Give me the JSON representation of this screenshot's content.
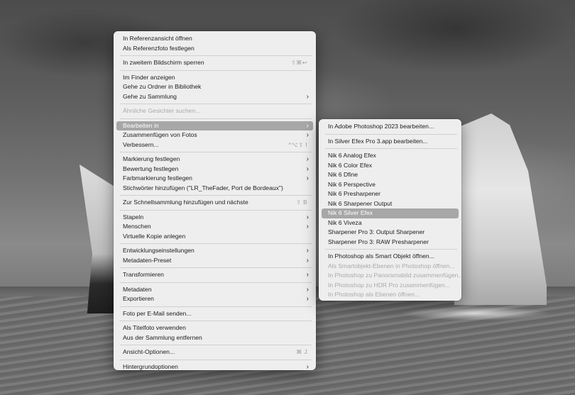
{
  "main_menu": [
    {
      "type": "item",
      "label": "In Referenzansicht öffnen"
    },
    {
      "type": "item",
      "label": "Als Referenzfoto festlegen"
    },
    {
      "type": "sep"
    },
    {
      "type": "item",
      "label": "In zweitem Bildschirm sperren",
      "shortcut": "⇧⌘↩"
    },
    {
      "type": "sep"
    },
    {
      "type": "item",
      "label": "Im Finder anzeigen"
    },
    {
      "type": "item",
      "label": "Gehe zu Ordner in Bibliothek"
    },
    {
      "type": "item",
      "label": "Gehe zu Sammlung",
      "submenu": true
    },
    {
      "type": "sep"
    },
    {
      "type": "item",
      "label": "Ähnliche Gesichter suchen...",
      "disabled": true
    },
    {
      "type": "sep"
    },
    {
      "type": "item",
      "label": "Bearbeiten in",
      "submenu": true,
      "highlight": true
    },
    {
      "type": "item",
      "label": "Zusammenfügen von Fotos",
      "submenu": true
    },
    {
      "type": "item",
      "label": "Verbessern...",
      "shortcut": "^⌥⇧ I"
    },
    {
      "type": "sep"
    },
    {
      "type": "item",
      "label": "Markierung festlegen",
      "submenu": true
    },
    {
      "type": "item",
      "label": "Bewertung festlegen",
      "submenu": true
    },
    {
      "type": "item",
      "label": "Farbmarkierung festlegen",
      "submenu": true
    },
    {
      "type": "item",
      "label": "Stichwörter hinzufügen (\"LR_TheFader, Port de Bordeaux\")"
    },
    {
      "type": "sep"
    },
    {
      "type": "item",
      "label": "Zur Schnellsammlung hinzufügen und nächste",
      "shortcut": "⇧ B"
    },
    {
      "type": "sep"
    },
    {
      "type": "item",
      "label": "Stapeln",
      "submenu": true
    },
    {
      "type": "item",
      "label": "Menschen",
      "submenu": true
    },
    {
      "type": "item",
      "label": "Virtuelle Kopie anlegen"
    },
    {
      "type": "sep"
    },
    {
      "type": "item",
      "label": "Entwicklungseinstellungen",
      "submenu": true
    },
    {
      "type": "item",
      "label": "Metadaten-Preset",
      "submenu": true
    },
    {
      "type": "sep"
    },
    {
      "type": "item",
      "label": "Transformieren",
      "submenu": true
    },
    {
      "type": "sep"
    },
    {
      "type": "item",
      "label": "Metadaten",
      "submenu": true
    },
    {
      "type": "item",
      "label": "Exportieren",
      "submenu": true
    },
    {
      "type": "sep"
    },
    {
      "type": "item",
      "label": "Foto per E-Mail senden..."
    },
    {
      "type": "sep"
    },
    {
      "type": "item",
      "label": "Als Titelfoto verwenden"
    },
    {
      "type": "item",
      "label": "Aus der Sammlung entfernen"
    },
    {
      "type": "sep"
    },
    {
      "type": "item",
      "label": "Ansicht-Optionen...",
      "shortcut": "⌘ J"
    },
    {
      "type": "sep"
    },
    {
      "type": "item",
      "label": "Hintergrundoptionen",
      "submenu": true
    }
  ],
  "sub_menu": [
    {
      "type": "item",
      "label": "In Adobe Photoshop 2023 bearbeiten..."
    },
    {
      "type": "sep"
    },
    {
      "type": "item",
      "label": "In Silver Efex Pro 3.app bearbeiten..."
    },
    {
      "type": "sep"
    },
    {
      "type": "item",
      "label": "Nik 6 Analog Efex"
    },
    {
      "type": "item",
      "label": "Nik 6 Color Efex"
    },
    {
      "type": "item",
      "label": "Nik 6 Dfine"
    },
    {
      "type": "item",
      "label": "Nik 6 Perspective"
    },
    {
      "type": "item",
      "label": "Nik 6 Presharpener"
    },
    {
      "type": "item",
      "label": "Nik 6 Sharpener Output"
    },
    {
      "type": "item",
      "label": "Nik 6 Silver Efex",
      "highlight": true
    },
    {
      "type": "item",
      "label": "Nik 6 Viveza"
    },
    {
      "type": "item",
      "label": "Sharpener Pro 3: Output Sharpener"
    },
    {
      "type": "item",
      "label": "Sharpener Pro 3: RAW Presharpener"
    },
    {
      "type": "sep"
    },
    {
      "type": "item",
      "label": "In Photoshop als Smart Objekt öffnen..."
    },
    {
      "type": "item",
      "label": "Als Smartobjekt-Ebenen in Photoshop öffnen...",
      "disabled": true
    },
    {
      "type": "item",
      "label": "In Photoshop zu Panoramabild zusammenfügen...",
      "disabled": true
    },
    {
      "type": "item",
      "label": "In Photoshop zu HDR Pro zusammenfügen...",
      "disabled": true
    },
    {
      "type": "item",
      "label": "In Photoshop als Ebenen öffnen...",
      "disabled": true
    }
  ],
  "icons": {
    "submenu_arrow": "›"
  },
  "colors": {
    "menu_bg": "#eeeeee",
    "highlight": "#a7a7a7",
    "disabled_text": "#aaaaaa"
  }
}
